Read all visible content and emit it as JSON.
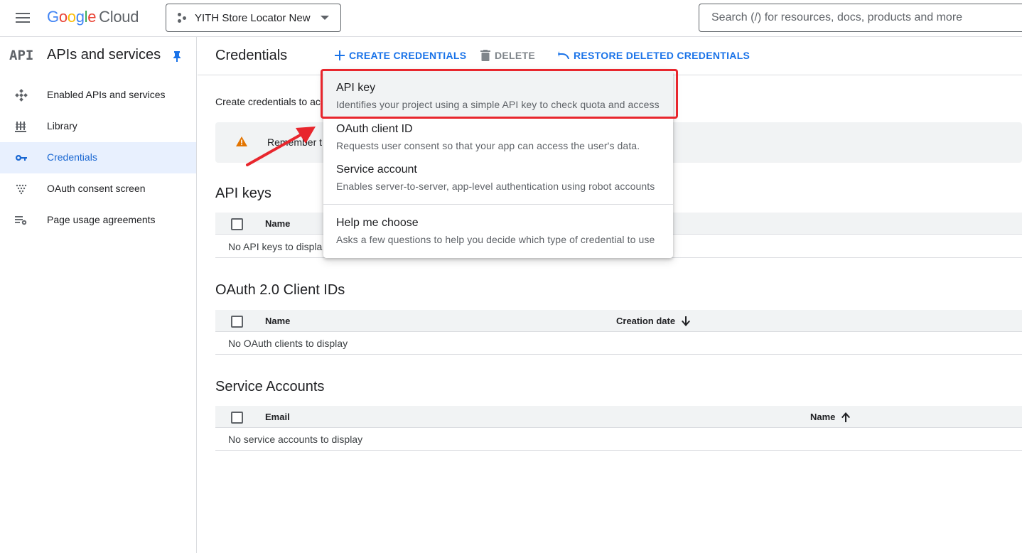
{
  "topbar": {
    "logo_letters": [
      "G",
      "o",
      "o",
      "g",
      "l",
      "e"
    ],
    "logo_cloud": "Cloud",
    "project_name": "YITH Store Locator New",
    "search_placeholder": "Search (/) for resources, docs, products and more"
  },
  "sidebar": {
    "logo_text": "API",
    "title": "APIs and services",
    "items": [
      {
        "label": "Enabled APIs and services",
        "icon": "api-nodes-icon",
        "active": false
      },
      {
        "label": "Library",
        "icon": "library-icon",
        "active": false
      },
      {
        "label": "Credentials",
        "icon": "key-icon",
        "active": true
      },
      {
        "label": "OAuth consent screen",
        "icon": "consent-dots-icon",
        "active": false
      },
      {
        "label": "Page usage agreements",
        "icon": "settings-list-icon",
        "active": false
      }
    ]
  },
  "main": {
    "title": "Credentials",
    "actions": {
      "create": "CREATE CREDENTIALS",
      "delete": "DELETE",
      "restore": "RESTORE DELETED CREDENTIALS"
    },
    "intro": "Create credentials to ac",
    "banner_text": "Remember t",
    "sections": {
      "api_keys": {
        "title": "API keys",
        "col_name": "Name",
        "empty": "No API keys to displa"
      },
      "oauth": {
        "title": "OAuth 2.0 Client IDs",
        "col_name": "Name",
        "col_date": "Creation date",
        "empty": "No OAuth clients to display"
      },
      "service": {
        "title": "Service Accounts",
        "col_email": "Email",
        "col_name": "Name",
        "empty": "No service accounts to display"
      }
    }
  },
  "menu": {
    "items": [
      {
        "title": "API key",
        "desc": "Identifies your project using a simple API key to check quota and access"
      },
      {
        "title": "OAuth client ID",
        "desc": "Requests user consent so that your app can access the user's data."
      },
      {
        "title": "Service account",
        "desc": "Enables server-to-server, app-level authentication using robot accounts"
      },
      {
        "title": "Help me choose",
        "desc": "Asks a few questions to help you decide which type of credential to use"
      }
    ]
  },
  "colors": {
    "accent": "#1a73e8",
    "annotation": "#e8262d",
    "active_bg": "#e8f0fe",
    "warning": "#e37400"
  }
}
